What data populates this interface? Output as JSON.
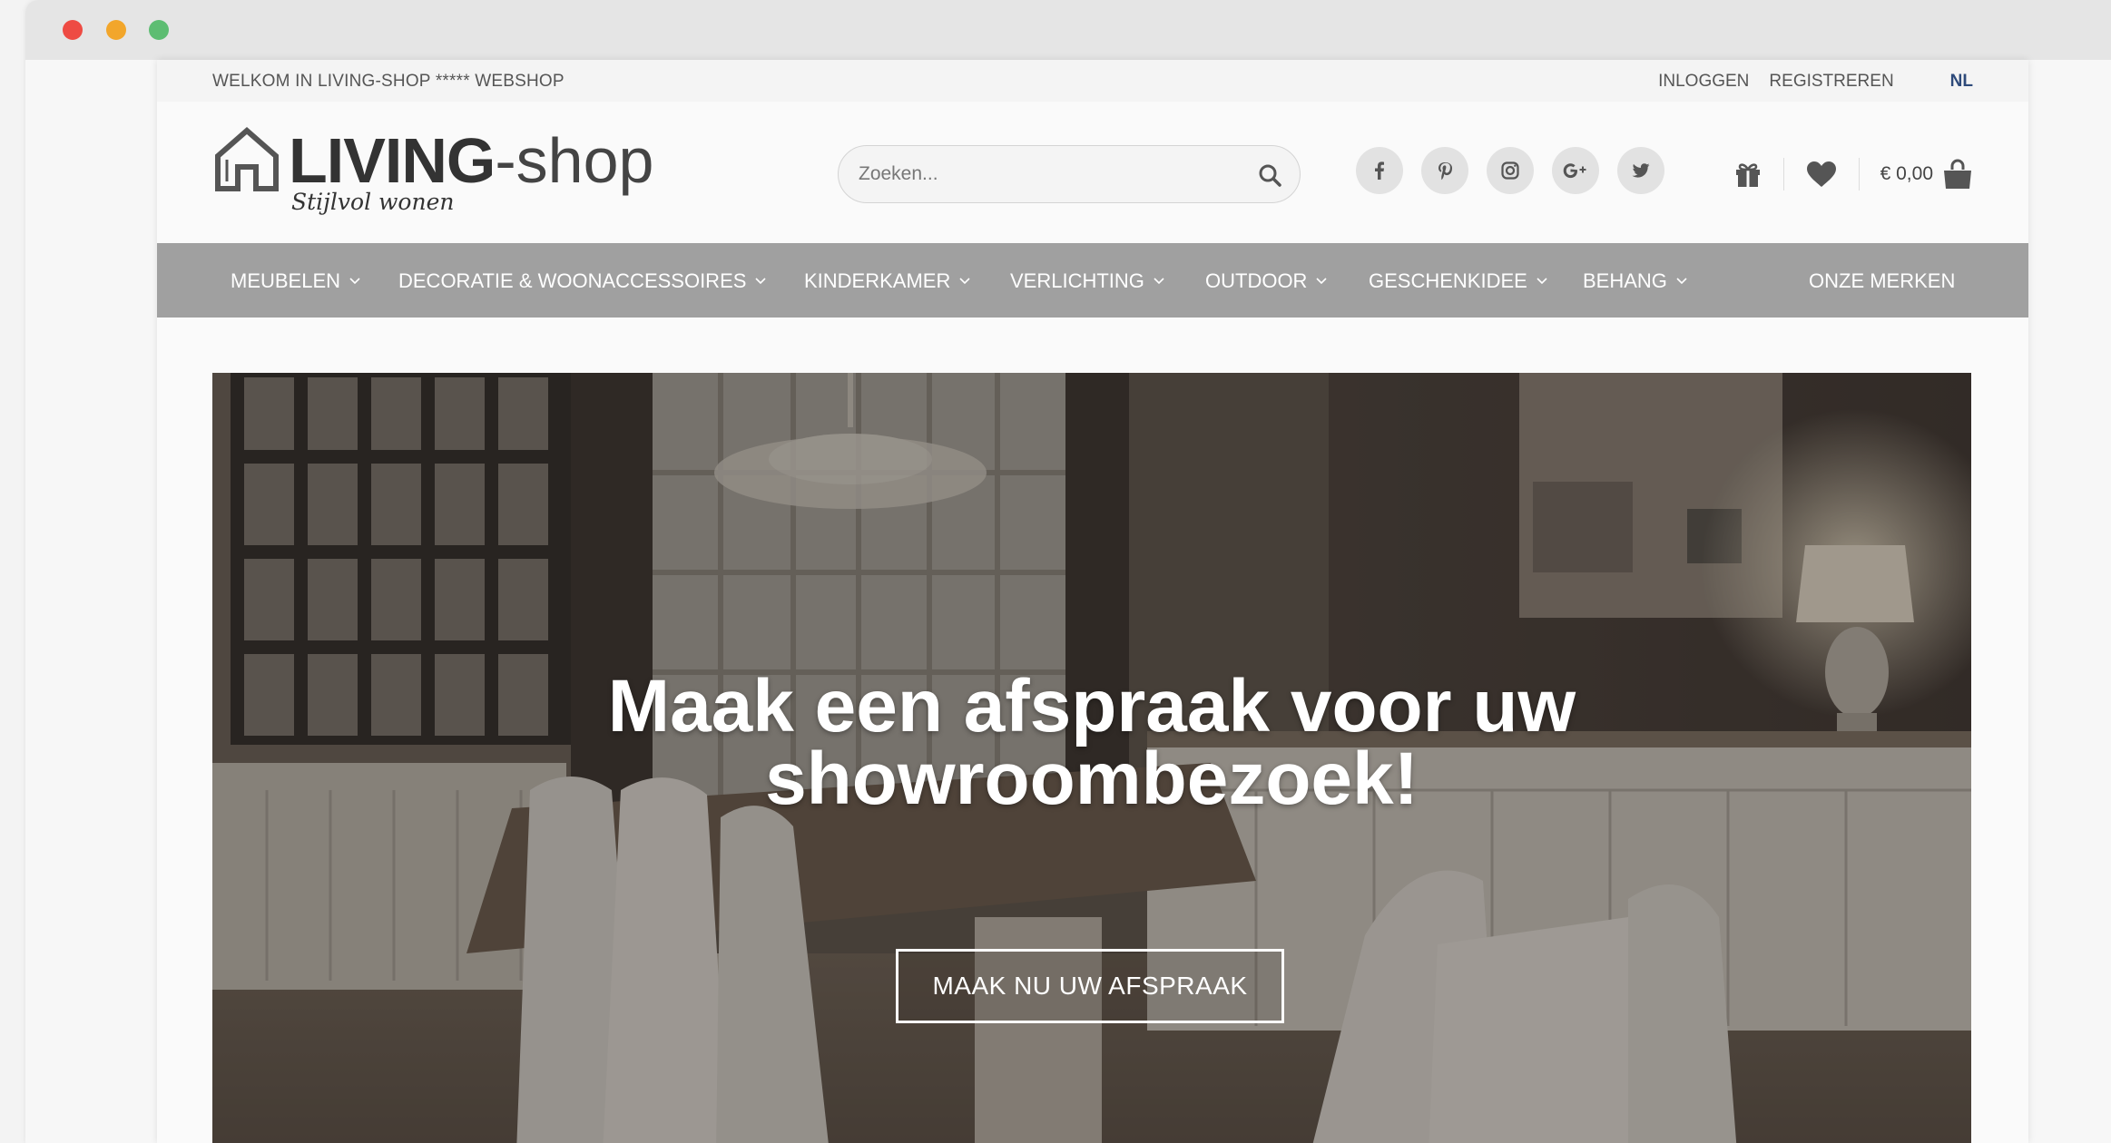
{
  "browser": {
    "colors": {
      "red": "#ee4b43",
      "yellow": "#f2a62b",
      "green": "#5dbd72"
    }
  },
  "topbar": {
    "welcome": "WELKOM IN LIVING-SHOP ***** WEBSHOP",
    "login": "INLOGGEN",
    "register": "REGISTREREN",
    "language": "NL"
  },
  "header": {
    "logo_bold": "LIVING",
    "logo_light": "-shop",
    "logo_tagline": "Stijlvol wonen",
    "search_placeholder": "Zoeken...",
    "socials": [
      {
        "icon": "facebook-icon",
        "glyph": "f"
      },
      {
        "icon": "pinterest-icon",
        "glyph": "P"
      },
      {
        "icon": "instagram-icon",
        "glyph": ""
      },
      {
        "icon": "google-plus-icon",
        "glyph": "G+"
      },
      {
        "icon": "twitter-icon",
        "glyph": ""
      }
    ],
    "cart_amount": "€ 0,00"
  },
  "nav": {
    "items": [
      {
        "label": "MEUBELEN",
        "dropdown": true
      },
      {
        "label": "DECORATIE & WOONACCESSOIRES",
        "dropdown": true
      },
      {
        "label": "KINDERKAMER",
        "dropdown": true
      },
      {
        "label": "VERLICHTING",
        "dropdown": true
      },
      {
        "label": "OUTDOOR",
        "dropdown": true
      },
      {
        "label": "GESCHENKIDEE",
        "dropdown": true
      },
      {
        "label": "BEHANG",
        "dropdown": true
      },
      {
        "label": "ONZE MERKEN",
        "dropdown": false
      }
    ]
  },
  "hero": {
    "title_line1": "Maak een afspraak voor uw",
    "title_line2": "showroombezoek!",
    "button": "MAAK NU UW AFSPRAAK"
  }
}
